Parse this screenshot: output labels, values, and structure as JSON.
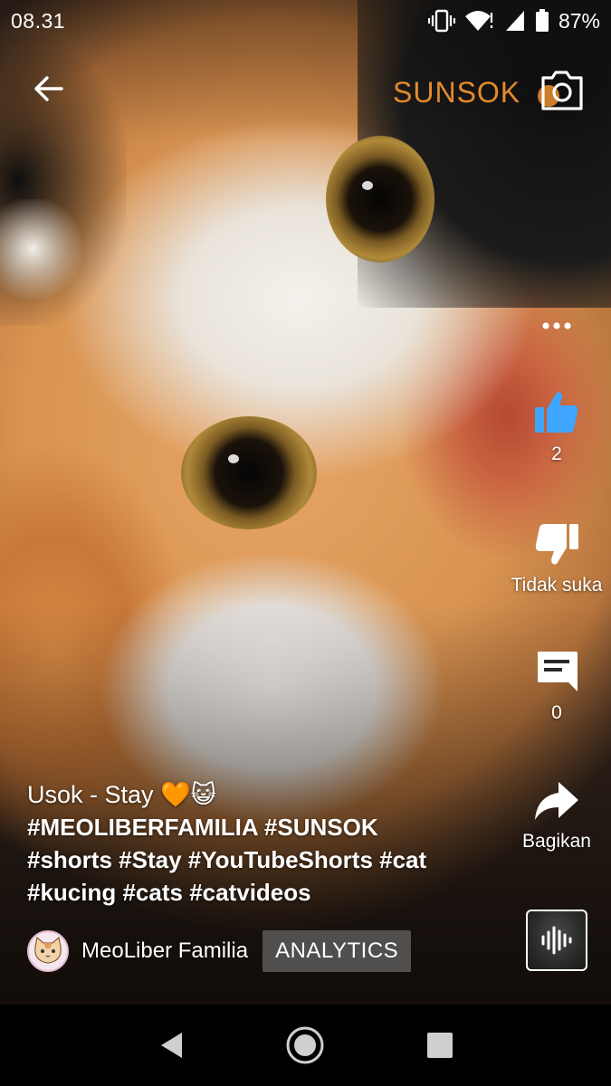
{
  "status_bar": {
    "time": "08.31",
    "battery": "87%",
    "icons": [
      "vibrate-icon",
      "wifi-icon",
      "signal-icon",
      "battery-icon"
    ]
  },
  "header": {
    "back_icon": "arrow-left-icon",
    "brand": "SUNSOK",
    "camera_icon": "camera-icon",
    "brand_color": "#e38a2c"
  },
  "actions": {
    "more_icon": "more-horizontal-icon",
    "like": {
      "icon": "thumbs-up-icon",
      "count": "2",
      "active_color": "#3ea6ff"
    },
    "dislike": {
      "icon": "thumbs-down-icon",
      "label": "Tidak suka"
    },
    "comments": {
      "icon": "comment-icon",
      "count": "0"
    },
    "share": {
      "icon": "share-icon",
      "label": "Bagikan"
    }
  },
  "caption": {
    "title": "Usok - Stay 🧡😺",
    "tags_line_1": "#MEOLIBERFAMILIA #SUNSOK",
    "tags_line_2": "#shorts #Stay #YouTubeShorts #cat",
    "tags_line_3": "#kucing #cats #catvideos"
  },
  "channel": {
    "name": "MeoLiber Familia",
    "analytics_label": "ANALYTICS",
    "avatar_icon": "cat-avatar-icon"
  },
  "sound": {
    "icon": "audio-wave-icon"
  },
  "nav_bar": {
    "back_icon": "nav-back-icon",
    "home_icon": "nav-home-icon",
    "recents_icon": "nav-recents-icon"
  }
}
